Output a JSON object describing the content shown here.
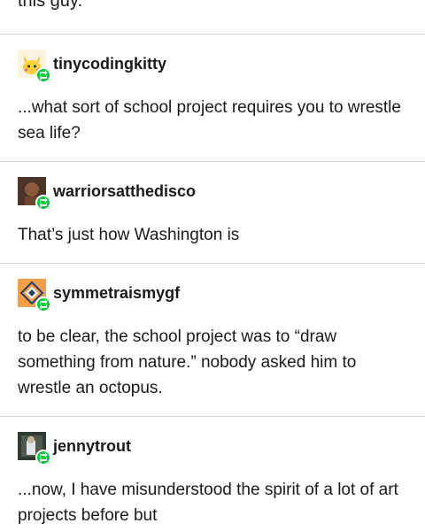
{
  "top_fragment": "this guy.",
  "posts": [
    {
      "username": "tinycodingkitty",
      "avatar_icon": "pikachu-avatar-icon",
      "text": "...what sort of school project requires you to wrestle sea life?"
    },
    {
      "username": "warriorsatthedisco",
      "avatar_icon": "photo-avatar-icon",
      "text": "That’s just how Washington is"
    },
    {
      "username": "symmetraismygf",
      "avatar_icon": "symmetra-logo-avatar-icon",
      "text": "to be clear, the school project was to “draw something from nature.” nobody asked him to wrestle an octopus."
    },
    {
      "username": "jennytrout",
      "avatar_icon": "photo-avatar-icon",
      "text": "...now, I have misunderstood the spirit of a lot of art projects before but"
    }
  ],
  "colors": {
    "reblog_badge": "#00cf35",
    "divider": "#d6d6d6",
    "text": "#1a1a1a"
  }
}
